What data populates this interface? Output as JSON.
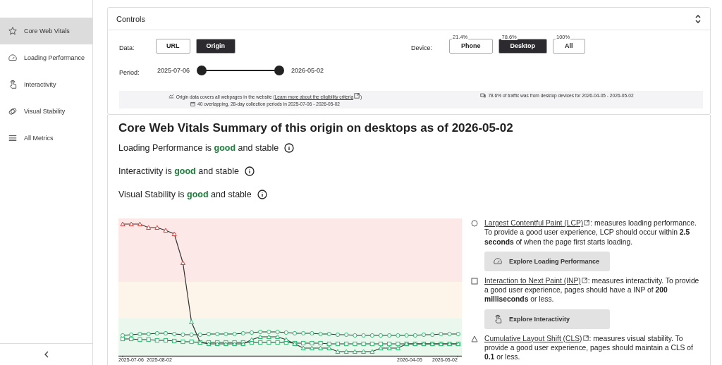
{
  "sidebar": {
    "items": [
      {
        "label": "Core Web Vitals",
        "selected": true
      },
      {
        "label": "Loading Performance",
        "selected": false
      },
      {
        "label": "Interactivity",
        "selected": false
      },
      {
        "label": "Visual Stability",
        "selected": false
      },
      {
        "label": "All Metrics",
        "selected": false
      }
    ]
  },
  "controls": {
    "title": "Controls",
    "expanded": true,
    "data": {
      "label": "Data:",
      "options": [
        {
          "label": "URL",
          "selected": false
        },
        {
          "label": "Origin",
          "selected": true
        }
      ]
    },
    "device": {
      "label": "Device:",
      "options": [
        {
          "label": "Phone",
          "share": "21.4%",
          "selected": false
        },
        {
          "label": "Desktop",
          "share": "78.6%",
          "selected": true
        },
        {
          "label": "All",
          "share": "100%",
          "selected": false
        }
      ]
    },
    "period": {
      "label": "Period:",
      "start": "2025-07-06",
      "end": "2026-05-02",
      "handles": [
        {
          "level": 0
        },
        {
          "level": 1
        }
      ]
    },
    "origin_note": {
      "text": "Origin data covers all webpages in the website (",
      "link": "Learn more about the eligibility criteria",
      "after": ")"
    },
    "periods_note": "40 overlapping, 28-day collection periods in 2025-07-06 - 2026-05-02",
    "traffic_note": "78.6% of traffic was from desktop devices for 2026-04-05 - 2026-05-02"
  },
  "summary": {
    "title": "Core Web Vitals Summary of this origin on desktops as of 2026-05-02",
    "statuses": [
      {
        "prefix": "Loading Performance is",
        "rating": "good",
        "suffix": "and stable"
      },
      {
        "prefix": "Interactivity is",
        "rating": "good",
        "suffix": "and stable"
      },
      {
        "prefix": "Visual Stability is",
        "rating": "good",
        "suffix": "and stable"
      }
    ]
  },
  "chart": {
    "axis_labels": [
      "2025-07-06",
      "2025-08-02",
      "2026-04-05",
      "2026-05-02"
    ]
  },
  "metrics": [
    {
      "link": "Largest Contentful Paint (LCP)",
      "text": ": measures loading performance. To provide a good user experience, LCP should occur within **2.5 seconds** of when the page first starts loading.",
      "button": "Explore Loading Performance"
    },
    {
      "link": "Interaction to Next Paint (INP)",
      "text": ": measures interactivity. To provide a good user experience, pages should have a INP of **200 milliseconds** or less.",
      "button": "Explore Interactivity"
    },
    {
      "link": "Cumulative Layout Shift (CLS)",
      "text": ": measures visual stability. To provide a good user experience, pages should maintain a CLS of **0.1** or less."
    }
  ]
}
